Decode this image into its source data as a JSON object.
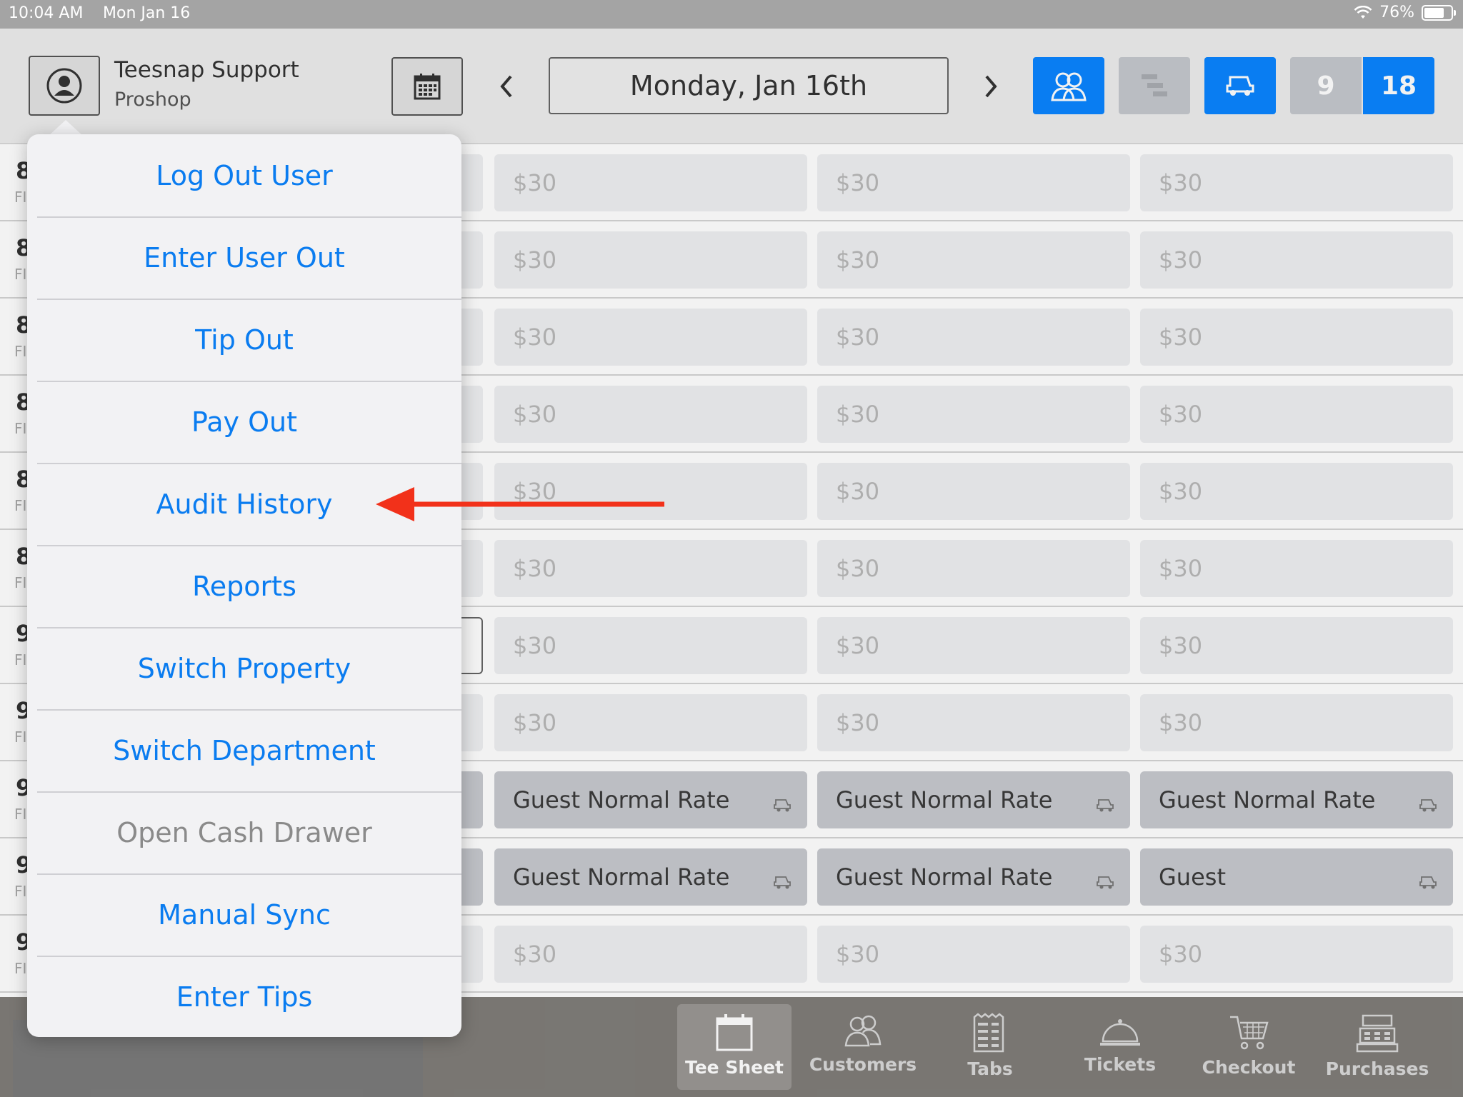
{
  "status_bar": {
    "time": "10:04 AM",
    "date": "Mon Jan 16",
    "battery": "76%",
    "battery_level": 0.76
  },
  "header": {
    "user_name": "Teesnap Support",
    "user_department": "Proshop",
    "current_date": "Monday, Jan 16th",
    "hole_options": [
      "9",
      "18"
    ],
    "selected_holes": "18"
  },
  "tee_sheet": {
    "rows": [
      {
        "time_prefix": "8",
        "sub_prefix": "FI",
        "slots": [
          "$30",
          "$30",
          "$30"
        ],
        "booked": [
          false,
          false,
          false
        ]
      },
      {
        "time_prefix": "8",
        "sub_prefix": "FI",
        "slots": [
          "$30",
          "$30",
          "$30"
        ],
        "booked": [
          false,
          false,
          false
        ]
      },
      {
        "time_prefix": "8",
        "sub_prefix": "FI",
        "slots": [
          "$30",
          "$30",
          "$30"
        ],
        "booked": [
          false,
          false,
          false
        ]
      },
      {
        "time_prefix": "8",
        "sub_prefix": "FI",
        "slots": [
          "$30",
          "$30",
          "$30"
        ],
        "booked": [
          false,
          false,
          false
        ]
      },
      {
        "time_prefix": "8",
        "sub_prefix": "FI",
        "slots": [
          "$30",
          "$30",
          "$30"
        ],
        "booked": [
          false,
          false,
          false
        ]
      },
      {
        "time_prefix": "8",
        "sub_prefix": "FI",
        "slots": [
          "$30",
          "$30",
          "$30"
        ],
        "booked": [
          false,
          false,
          false
        ]
      },
      {
        "time_prefix": "9",
        "sub_prefix": "FI",
        "slots": [
          "$30",
          "$30",
          "$30"
        ],
        "booked": [
          false,
          false,
          false
        ]
      },
      {
        "time_prefix": "9",
        "sub_prefix": "FI",
        "slots": [
          "$30",
          "$30",
          "$30"
        ],
        "booked": [
          false,
          false,
          false
        ]
      },
      {
        "time_prefix": "9",
        "sub_prefix": "FI",
        "slots": [
          "Guest Normal Rate",
          "Guest Normal Rate",
          "Guest Normal Rate"
        ],
        "booked": [
          true,
          true,
          true
        ]
      },
      {
        "time_prefix": "9",
        "sub_prefix": "FI",
        "slots": [
          "Guest Normal Rate",
          "Guest Normal Rate",
          "Guest"
        ],
        "booked": [
          true,
          true,
          true
        ]
      },
      {
        "time_prefix": "9",
        "sub_prefix": "FI",
        "slots": [
          "$30",
          "$30",
          "$30"
        ],
        "booked": [
          false,
          false,
          false
        ]
      }
    ]
  },
  "menu": {
    "items": [
      {
        "label": "Log Out User",
        "enabled": true
      },
      {
        "label": "Enter User Out",
        "enabled": true
      },
      {
        "label": "Tip Out",
        "enabled": true
      },
      {
        "label": "Pay Out",
        "enabled": true
      },
      {
        "label": "Audit History",
        "enabled": true
      },
      {
        "label": "Reports",
        "enabled": true
      },
      {
        "label": "Switch Property",
        "enabled": true
      },
      {
        "label": "Switch Department",
        "enabled": true
      },
      {
        "label": "Open Cash Drawer",
        "enabled": false
      },
      {
        "label": "Manual Sync",
        "enabled": true
      },
      {
        "label": "Enter Tips",
        "enabled": true
      }
    ]
  },
  "tab_bar": {
    "tabs": [
      {
        "label": "Tee Sheet",
        "icon": "calendar-icon",
        "active": true
      },
      {
        "label": "Customers",
        "icon": "people-icon",
        "active": false
      },
      {
        "label": "Tabs",
        "icon": "list-icon",
        "active": false
      },
      {
        "label": "Tickets",
        "icon": "cloche-icon",
        "active": false
      },
      {
        "label": "Checkout",
        "icon": "cart-icon",
        "active": false
      },
      {
        "label": "Purchases",
        "icon": "register-icon",
        "active": false
      }
    ]
  },
  "colors": {
    "accent": "#0a84ff",
    "menu_text": "#0a7cf0",
    "annotation_arrow": "#f2311a"
  }
}
